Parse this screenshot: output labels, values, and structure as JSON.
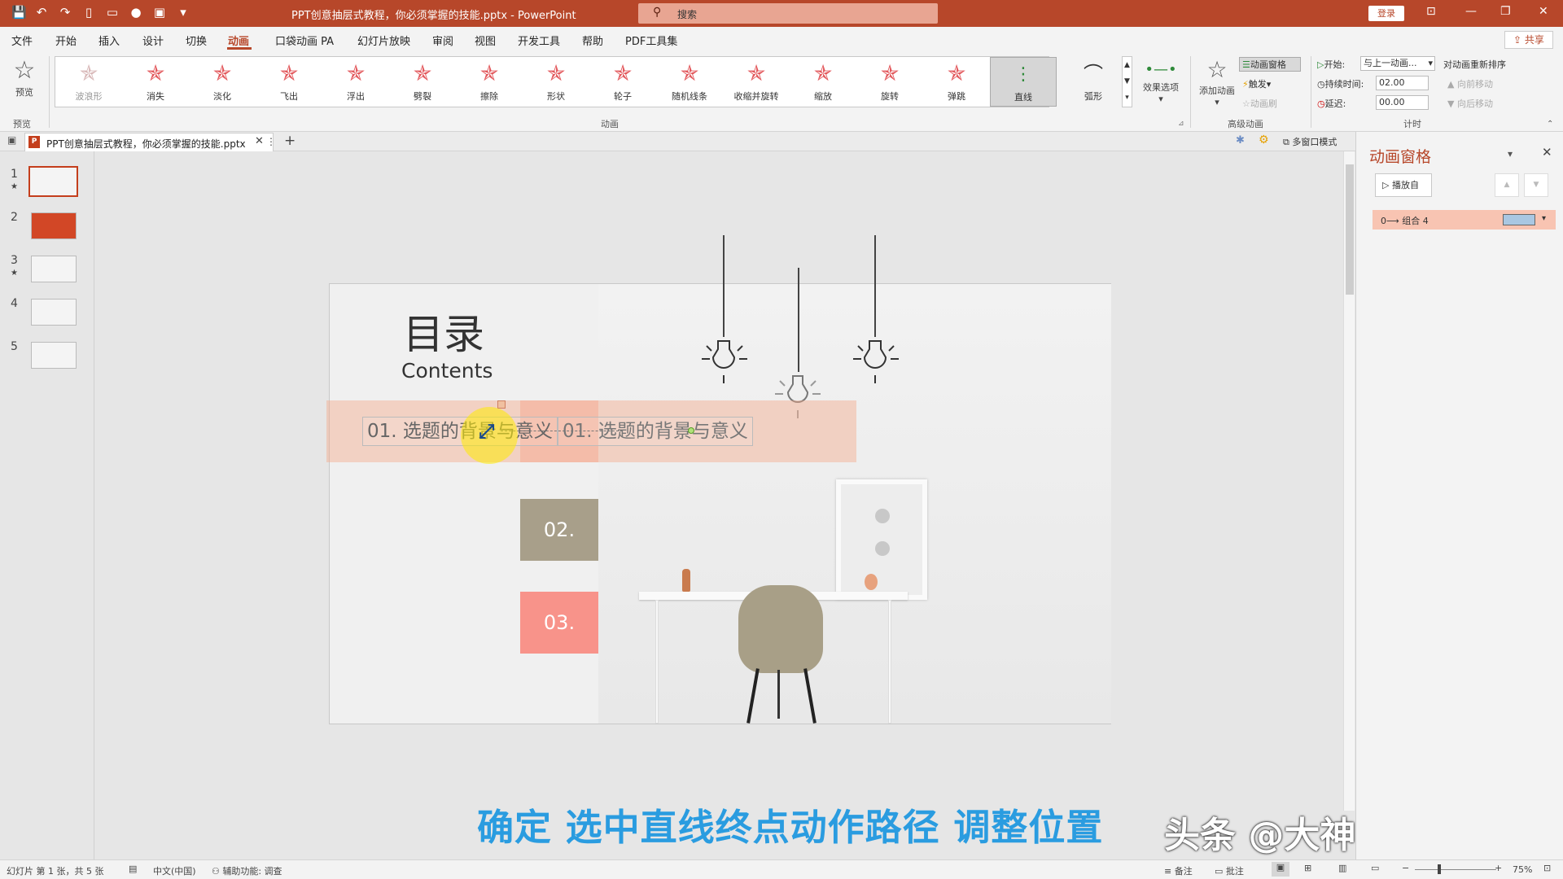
{
  "titlebar": {
    "doc_title": "PPT创意抽层式教程，你必须掌握的技能.pptx  -  PowerPoint",
    "search_placeholder": "搜索",
    "login": "登录"
  },
  "menu": [
    "文件",
    "开始",
    "插入",
    "设计",
    "切换",
    "动画",
    "口袋动画 PA",
    "幻灯片放映",
    "审阅",
    "视图",
    "开发工具",
    "帮助",
    "PDF工具集"
  ],
  "share": "共享",
  "ribbon": {
    "preview": "预览",
    "preview_group": "预览",
    "animations": [
      {
        "name": "波浪形",
        "disabled": true
      },
      {
        "name": "消失",
        "disabled": false
      },
      {
        "name": "淡化",
        "disabled": false
      },
      {
        "name": "飞出",
        "disabled": false
      },
      {
        "name": "浮出",
        "disabled": false
      },
      {
        "name": "劈裂",
        "disabled": false
      },
      {
        "name": "擦除",
        "disabled": false
      },
      {
        "name": "形状",
        "disabled": false
      },
      {
        "name": "轮子",
        "disabled": false
      },
      {
        "name": "随机线条",
        "disabled": false
      },
      {
        "name": "收缩并旋转",
        "disabled": false
      },
      {
        "name": "缩放",
        "disabled": false
      },
      {
        "name": "旋转",
        "disabled": false
      },
      {
        "name": "弹跳",
        "disabled": false
      }
    ],
    "line_path": "直线",
    "arc_path": "弧形",
    "effect_options": "效果选项",
    "anim_group": "动画",
    "add_anim": "添加动画",
    "anim_pane_btn": "动画窗格",
    "trigger": "触发",
    "anim_painter": "动画刷",
    "adv_group": "高级动画",
    "start_label": "开始:",
    "start_value": "与上一动画...",
    "duration_label": "持续时间:",
    "duration_value": "02.00",
    "delay_label": "延迟:",
    "delay_value": "00.00",
    "reorder": "对动画重新排序",
    "move_earlier": "向前移动",
    "move_later": "向后移动",
    "timing_group": "计时"
  },
  "doctab": {
    "name": "PPT创意抽层式教程，你必须掌握的技能.pptx",
    "multiwindow": "多窗口模式"
  },
  "thumbs": [
    {
      "num": "1",
      "star": true
    },
    {
      "num": "2",
      "star": false
    },
    {
      "num": "3",
      "star": true
    },
    {
      "num": "4",
      "star": false
    },
    {
      "num": "5",
      "star": false
    }
  ],
  "slide": {
    "title": "目录",
    "subtitle": "Contents",
    "item1": "01.   选题的背景与意义",
    "item1_ghost": "01.   选题的背景与意义",
    "num2": "02.",
    "num3": "03."
  },
  "caption": "确定 选中直线终点动作路径 调整位置",
  "watermark": "头条 @大神PPT课堂",
  "pane": {
    "title": "动画窗格",
    "play_from": "播放自",
    "item": "0⟶ 组合 4"
  },
  "status": {
    "slide_info": "幻灯片 第 1 张，共 5 张",
    "lang": "中文(中国)",
    "accessibility": "辅助功能: 调查",
    "notes": "备注",
    "comments": "批注",
    "zoom": "75%"
  },
  "colors": {
    "accent": "#b7472a",
    "caption": "#2a9ce0",
    "num2": "#a89f8a",
    "num3": "#f8938a"
  }
}
